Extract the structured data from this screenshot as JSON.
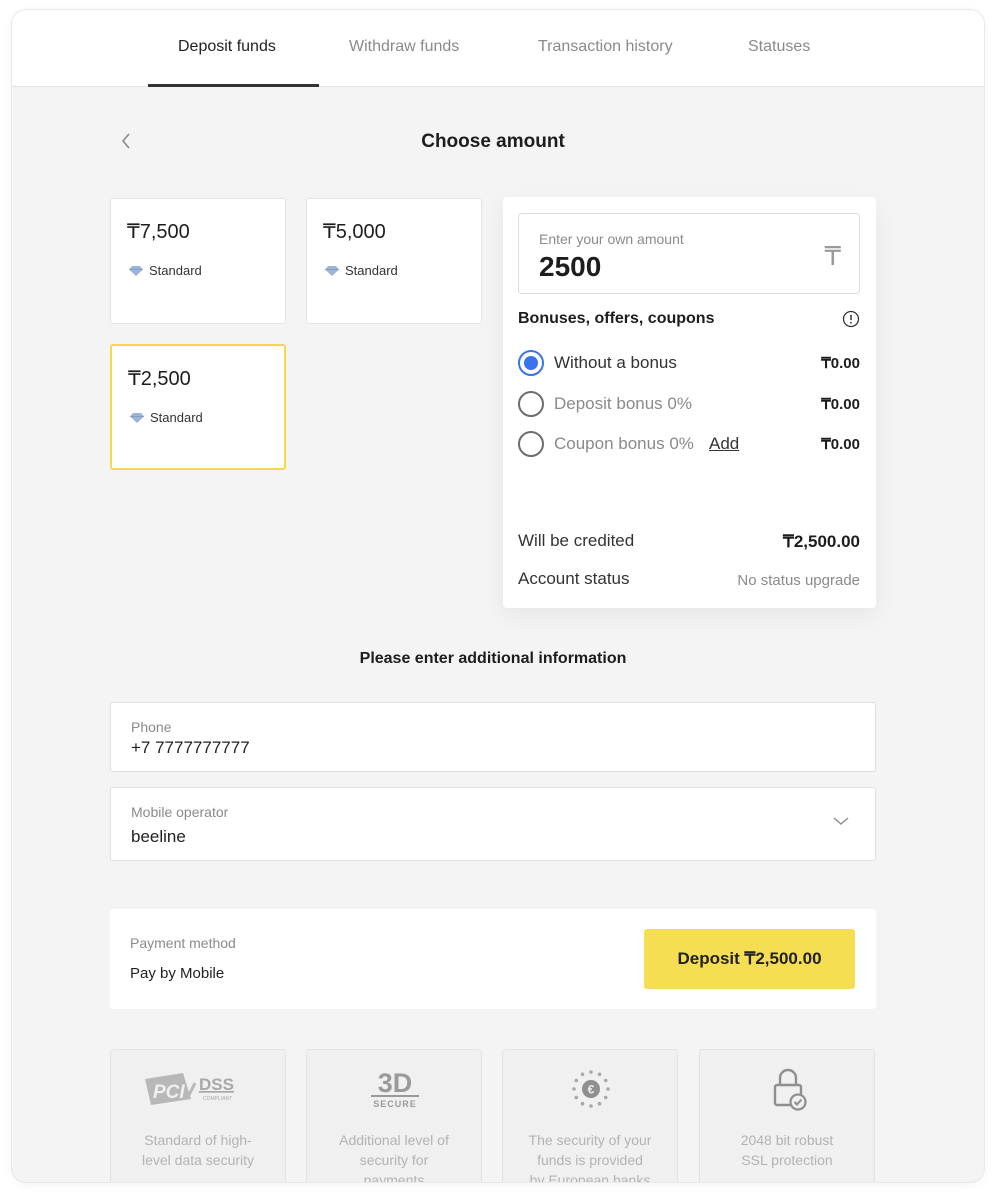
{
  "tabs": [
    {
      "label": "Deposit funds",
      "active": true
    },
    {
      "label": "Withdraw funds",
      "active": false
    },
    {
      "label": "Transaction history",
      "active": false
    },
    {
      "label": "Statuses",
      "active": false
    }
  ],
  "header": {
    "title": "Choose amount",
    "back_icon": "chevron-left-icon"
  },
  "amount_options": [
    {
      "amount": "₸7,500",
      "tier": "Standard",
      "selected": false
    },
    {
      "amount": "₸5,000",
      "tier": "Standard",
      "selected": false
    },
    {
      "amount": "₸2,500",
      "tier": "Standard",
      "selected": true
    }
  ],
  "own_amount": {
    "label": "Enter your own amount",
    "value": "2500",
    "currency_symbol": "₸"
  },
  "bonuses": {
    "heading": "Bonuses, offers, coupons",
    "options": [
      {
        "label": "Without a bonus",
        "amount": "₸0.00",
        "selected": true
      },
      {
        "label": "Deposit bonus 0%",
        "amount": "₸0.00",
        "selected": false
      },
      {
        "label": "Coupon bonus 0%",
        "amount": "₸0.00",
        "selected": false,
        "link": "Add"
      }
    ]
  },
  "summary": {
    "credited_label": "Will be credited",
    "credited_value": "₸2,500.00",
    "status_label": "Account status",
    "status_value": "No status upgrade"
  },
  "additional_info": {
    "heading": "Please enter additional information",
    "phone": {
      "label": "Phone",
      "value": "+7 7777777777"
    },
    "operator": {
      "label": "Mobile operator",
      "value": "beeline"
    }
  },
  "payment": {
    "label": "Payment method",
    "method": "Pay by Mobile",
    "button": "Deposit ₸2,500.00"
  },
  "security": [
    {
      "icon": "pci-dss-logo",
      "logo_text": "PCI DSS",
      "caption_lines": [
        "Standard of high-",
        "level data security"
      ]
    },
    {
      "icon": "3d-secure-logo",
      "logo_text": "3D SECURE",
      "caption_lines": [
        "Additional level of",
        "security for",
        "payments"
      ]
    },
    {
      "icon": "euro-stars-icon",
      "caption_lines": [
        "The security of your",
        "funds is provided",
        "by European banks"
      ]
    },
    {
      "icon": "lock-check-icon",
      "caption_lines": [
        "2048 bit robust",
        "SSL protection"
      ]
    }
  ],
  "colors": {
    "accent_yellow": "#f6de52",
    "radio_blue": "#3b73ef",
    "selected_border": "#f5d84b"
  }
}
